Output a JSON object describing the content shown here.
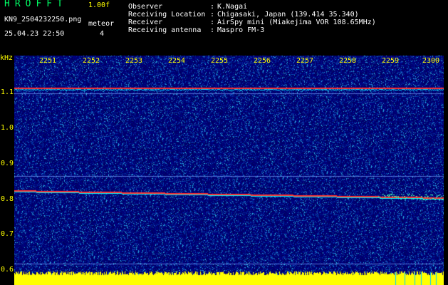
{
  "header": {
    "app_title": "HROFFT",
    "version": "1.00f",
    "filename": "KN9_2504232250.png",
    "datetime": "25.04.23 22:50",
    "mode_label": "meteor",
    "mode_value": "4"
  },
  "station_info": [
    {
      "label": "Observer",
      "value": "K.Nagai"
    },
    {
      "label": "Receiving Location",
      "value": "Chigasaki, Japan (139.414 35.340)"
    },
    {
      "label": "Receiver",
      "value": "AirSpy mini (Miakejima VOR 108.65MHz)"
    },
    {
      "label": "Receiving antenna",
      "value": "Maspro FM-3"
    }
  ],
  "axis": {
    "y_unit": "kHz",
    "y_ticks": [
      "1.1",
      "1.0",
      "0.9",
      "0.8",
      "0.7",
      "0.6"
    ],
    "x_ticks": [
      "2251",
      "2252",
      "2253",
      "2254",
      "2255",
      "2256",
      "2257",
      "2258",
      "2259",
      "2300"
    ]
  },
  "colors": {
    "background": "#00007a",
    "label_yellow": "#ffff00",
    "title_green": "#00ff66",
    "signal_red": "#ff3030",
    "signal_cyan": "#00ffff",
    "noise_floor": "#ffff00"
  }
}
